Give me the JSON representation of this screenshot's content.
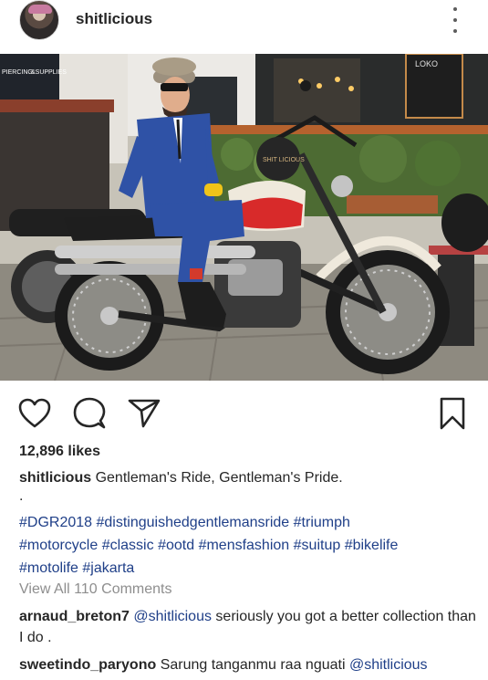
{
  "post": {
    "username": "shitlicious",
    "likes": "12,896 likes",
    "caption_user": "shitlicious",
    "caption_text": "Gentleman's Ride, Gentleman's Pride.",
    "caption_dot": ".",
    "hashtags": [
      "#DGR2018",
      "#distinguishedgentlemansride",
      "#triumph",
      "#motorcycle",
      "#classic",
      "#ootd",
      "#mensfashion",
      "#suitup",
      "#bikelife",
      "#motolife",
      "#jakarta"
    ],
    "view_all": "View All 110 Comments"
  },
  "photo": {
    "sign_left_1": "PIERCING",
    "sign_left_2": "&SUPPLIES",
    "sign_right": "LOKO",
    "helmet_text": "SHIT LICIOUS"
  },
  "comments": [
    {
      "user": "arnaud_breton7",
      "mention": "@shitlicious",
      "text": " seriously you got a better collection than I do ."
    },
    {
      "user": "sweetindo_paryono",
      "text": " Sarung tanganmu raa nguati ",
      "mention": "@shitlicious"
    }
  ],
  "icons": {
    "like": "heart-icon",
    "comment": "comment-icon",
    "share": "share-icon",
    "save": "bookmark-icon",
    "more": "more-icon"
  },
  "colors": {
    "link": "#1f3f88",
    "muted": "#8e8e8e",
    "text": "#262626"
  }
}
